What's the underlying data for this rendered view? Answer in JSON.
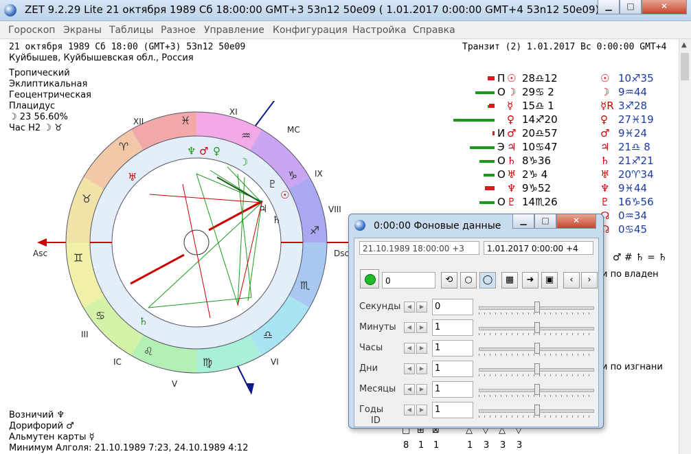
{
  "window": {
    "title": "ZET 9.2.29 Lite    21 октября 1989   Сб   18:00:00 GMT+3 53n12  50e09   ( 1.01.2017   0:00:00 GMT+4 53n12 50e09)"
  },
  "menu": [
    "Гороскоп",
    "Экраны",
    "Таблицы",
    "Разное",
    "Управление",
    "Конфигурация",
    "Настройка",
    "Справка"
  ],
  "header": {
    "natal_line": "21 октября 1989  Сб  18:00 (GMT+3) 53n12  50e09",
    "place": "Куйбышев, Куйбышевская обл., Россия",
    "transit_line": "Транзит (2)  1.01.2017  Вс  0:00:00 GMT+4"
  },
  "settings": [
    "Тропический",
    "Эклиптикальная",
    "Геоцентрическая",
    "Плацидус",
    "☽  23 56.60%",
    "Час Н2 ☽ ♉"
  ],
  "wheel": {
    "houses": [
      "XII",
      "XI",
      "MC",
      "IX",
      "VIII",
      "Dsc",
      "VI",
      "V",
      "IC",
      "III",
      "Asc"
    ],
    "signs": [
      "♓",
      "♒",
      "♑",
      "♐",
      "♏",
      "♎",
      "♍",
      "♌",
      "♋",
      "♊",
      "♉",
      "♈"
    ],
    "inner_planets": [
      "♆",
      "♂",
      "♀",
      "☽",
      "♅",
      "♇",
      "☉",
      "♃",
      "♄",
      "♄"
    ]
  },
  "planets": [
    {
      "aspect": "П",
      "glyph": "☉",
      "pos": "28♎12",
      "tglyph": "☉",
      "tpos": "10♐35",
      "bar": 0,
      "red": 10
    },
    {
      "aspect": "О",
      "glyph": "☽",
      "pos": "29♋ 2",
      "tglyph": "☽",
      "tpos": "9♒44",
      "bar": 28,
      "red": 0
    },
    {
      "aspect": "",
      "glyph": "☿",
      "pos": "15♎ 1",
      "tglyph": "☿R",
      "tpos": "3♐28",
      "bar": 10,
      "red": 8
    },
    {
      "aspect": "",
      "glyph": "♀",
      "pos": "14♐20",
      "tglyph": "♀",
      "tpos": "27♓19",
      "bar": 60,
      "red": 0
    },
    {
      "aspect": "И",
      "glyph": "♂",
      "pos": "20♎57",
      "tglyph": "♂",
      "tpos": "9♓24",
      "bar": 0,
      "red": 3
    },
    {
      "aspect": "Э",
      "glyph": "♃",
      "pos": "10♋47",
      "tglyph": "♃",
      "tpos": "21♎ 8",
      "bar": 36,
      "red": 0
    },
    {
      "aspect": "О",
      "glyph": "♄",
      "pos": "8♑36",
      "tglyph": "♄",
      "tpos": "21♐21",
      "bar": 22,
      "red": 0
    },
    {
      "aspect": "О",
      "glyph": "♅",
      "pos": "2♑ 4",
      "tglyph": "♅",
      "tpos": "20♈34",
      "bar": 16,
      "red": 0
    },
    {
      "aspect": "",
      "glyph": "♆",
      "pos": "9♑52",
      "tglyph": "♆",
      "tpos": "9♓44",
      "bar": 14,
      "red": 14
    },
    {
      "aspect": "О",
      "glyph": "♇",
      "pos": "14♏26",
      "tglyph": "♇",
      "tpos": "16♑56",
      "bar": 22,
      "red": 0
    },
    {
      "aspect": "",
      "glyph": "",
      "pos": "",
      "tglyph": "☊",
      "tpos": "0♒34",
      "bar": 0,
      "red": 0
    },
    {
      "aspect": "",
      "glyph": "",
      "pos": "",
      "tglyph": "☊",
      "tpos": "0♋45",
      "bar": 0,
      "red": 0
    }
  ],
  "right_panel": {
    "formula": "♂ # ♄ = ♄",
    "rulership_title": "и по владен",
    "exile_title": "и по изгнани"
  },
  "footer": {
    "lines": [
      "Возничий  ♆",
      "Дорифорий  ♂",
      "Альмутен карты  ☿",
      "Минимум Алголя: 21.10.1989  7:23,  24.10.1989  4:12"
    ],
    "counts_symbols": [
      "□",
      "⊞",
      "⊠",
      "△",
      "▽",
      "△",
      "▽"
    ],
    "counts": [
      "8",
      "1",
      "1",
      "1",
      "3",
      "3",
      "3"
    ]
  },
  "dialog": {
    "title": "0:00:00 Фоновые данные",
    "natal_field": "21.10.1989  18:00:00  +3",
    "transit_field": "1.01.2017   0:00:00  +4",
    "step_field": "0",
    "rows": [
      {
        "label": "Секунды",
        "value": "0",
        "knob": 0.5
      },
      {
        "label": "Минуты",
        "value": "1",
        "knob": 0.5
      },
      {
        "label": "Часы",
        "value": "1",
        "knob": 0.5
      },
      {
        "label": "Дни",
        "value": "1",
        "knob": 0.5
      },
      {
        "label": "Месяцы",
        "value": "1",
        "knob": 0.5
      },
      {
        "label": "Годы",
        "value": "1",
        "knob": 0.5
      }
    ],
    "partial_label": "ID"
  }
}
